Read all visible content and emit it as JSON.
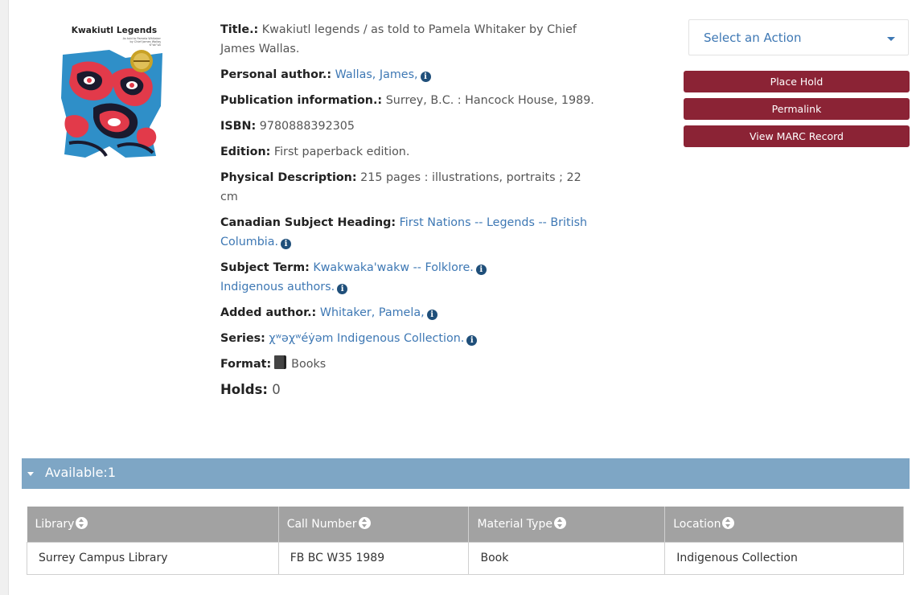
{
  "cover": {
    "title": "Kwakiutl Legends",
    "subtitle_lines": [
      "As told to Pamela Whitaker",
      "by Chief James Wallas",
      "Kʷakʷəƛ̓"
    ]
  },
  "record": {
    "title_label": "Title.:",
    "title_value": "Kwakiutl legends / as told to Pamela Whitaker by Chief James Wallas.",
    "personal_author_label": "Personal author.:",
    "personal_author_value": "Wallas, James,",
    "publication_label": "Publication information.:",
    "publication_value": "Surrey, B.C. : Hancock House, 1989.",
    "isbn_label": "ISBN:",
    "isbn_value": "9780888392305",
    "edition_label": "Edition:",
    "edition_value": "First paperback edition.",
    "physical_label": "Physical Description:",
    "physical_value": "215 pages : illustrations, portraits ; 22 cm",
    "csh_label": "Canadian Subject Heading:",
    "csh_value": "First Nations -- Legends -- British Columbia.",
    "subject_label": "Subject Term:",
    "subject_values": [
      "Kwakwaka'wakw -- Folklore.",
      "Indigenous authors."
    ],
    "added_author_label": "Added author.:",
    "added_author_value": "Whitaker, Pamela,",
    "series_label": "Series:",
    "series_value": "χʷəχʷéẏəm Indigenous Collection.",
    "format_label": "Format:",
    "format_value": "Books",
    "holds_label": "Holds:",
    "holds_value": "0"
  },
  "actions": {
    "select_label": "Select an Action",
    "place_hold": "Place Hold",
    "permalink": "Permalink",
    "view_marc": "View MARC Record"
  },
  "availability": {
    "label": "Available:1",
    "columns": [
      "Library",
      "Call Number",
      "Material Type",
      "Location"
    ],
    "rows": [
      [
        "Surrey Campus Library",
        "FB BC W35 1989",
        "Book",
        "Indigenous Collection"
      ]
    ]
  },
  "colors": {
    "button": "#8b2335",
    "link": "#3e78b4",
    "availability_bar": "#7ea6c5",
    "table_header": "#a2a2a2"
  }
}
